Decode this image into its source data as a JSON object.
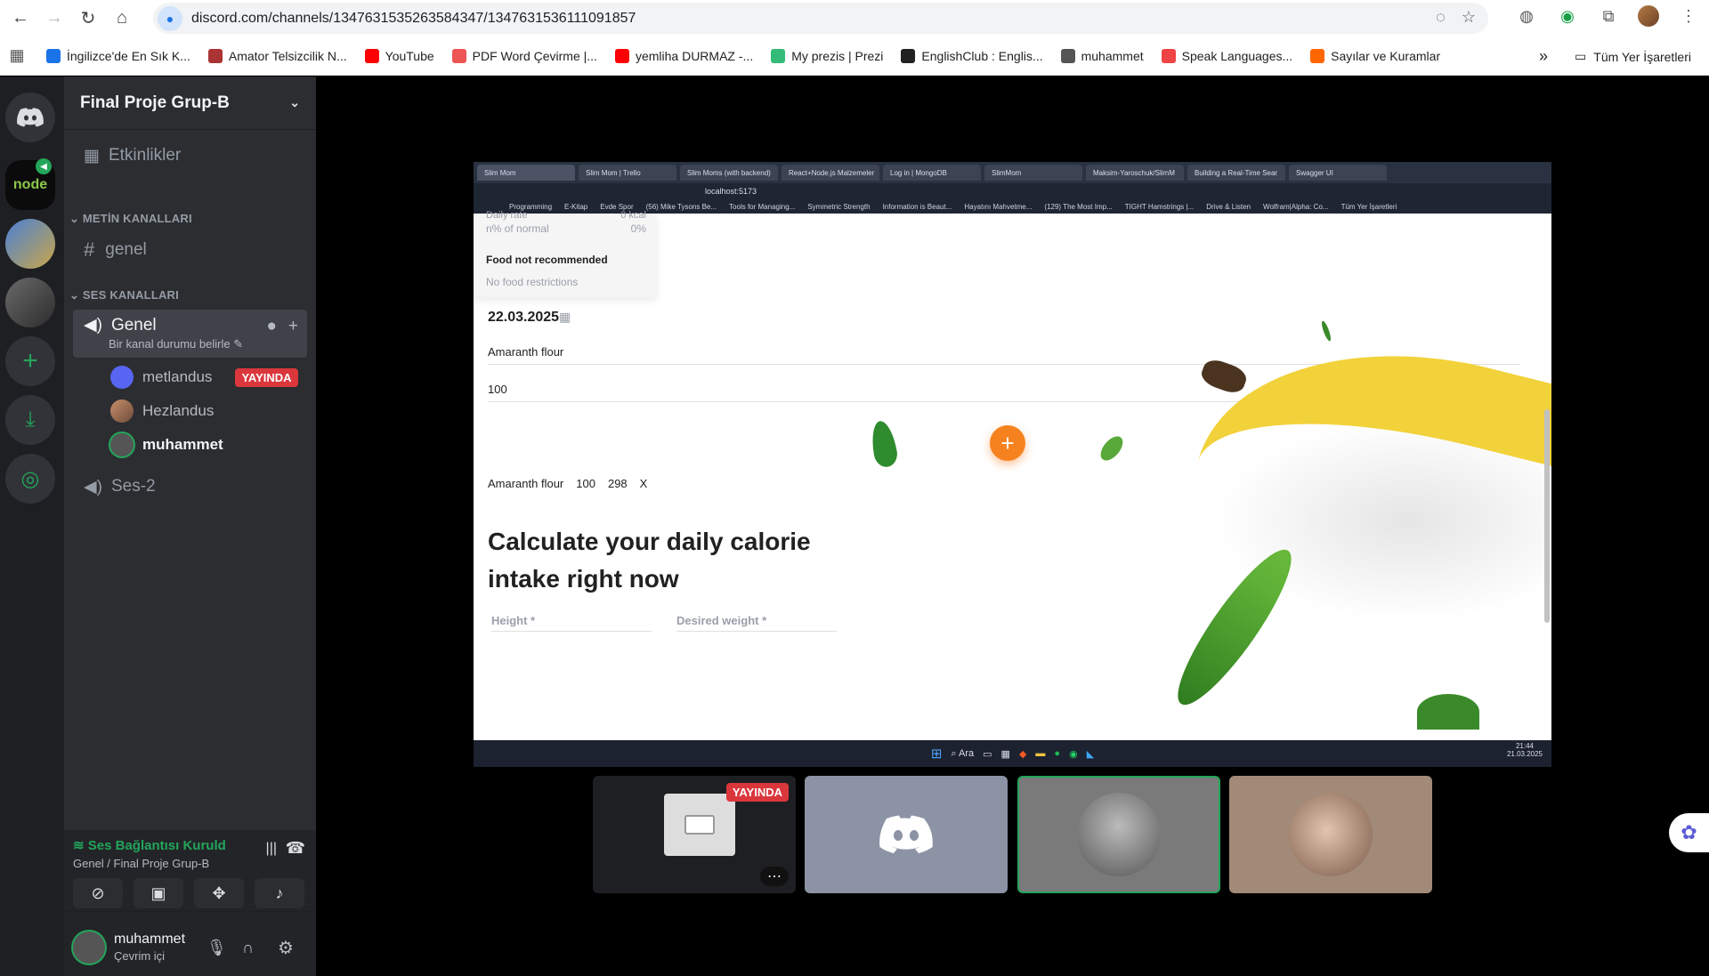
{
  "browser": {
    "url": "discord.com/channels/1347631535263584347/1347631536111091857",
    "bookmarks": [
      {
        "label": "İngilizce'de En Sık K...",
        "color": "#1a73e8"
      },
      {
        "label": "Amator Telsizcilik N...",
        "color": "#a33"
      },
      {
        "label": "YouTube",
        "color": "#f00"
      },
      {
        "label": "PDF Word Çevirme |...",
        "color": "#e55"
      },
      {
        "label": "yemliha DURMAZ -...",
        "color": "#f00"
      },
      {
        "label": "My prezis | Prezi",
        "color": "#3b7"
      },
      {
        "label": "EnglishClub : Englis...",
        "color": "#222"
      },
      {
        "label": "muhammet",
        "color": "#555"
      },
      {
        "label": "Speak Languages...",
        "color": "#e44"
      },
      {
        "label": "Sayılar ve Kuramlar",
        "color": "#f60"
      }
    ],
    "bookmarks_more": "»",
    "all_bookmarks": "Tüm Yer İşaretleri"
  },
  "discord": {
    "server_name": "Final Proje Grup-B",
    "events": "Etkinlikler",
    "text_category": "METİN KANALLARI",
    "text_channel": "genel",
    "voice_category": "SES KANALLARI",
    "voice_channel": "Genel",
    "voice_channel_status": "Bir kanal durumu belirle",
    "voice_users": [
      {
        "name": "metlandus",
        "live": "YAYINDA"
      },
      {
        "name": "Hezlandus"
      },
      {
        "name": "muhammet"
      }
    ],
    "voice_channel_2": "Ses-2",
    "connection_status": "Ses Bağlantısı Kuruld",
    "connection_sub": "Genel / Final Proje Grup-B",
    "user_name": "muhammet",
    "user_status": "Çevrim içi"
  },
  "shared_screen": {
    "tabs": [
      "Slim Mom",
      "Slim Mom | Trello",
      "Slim Moms (with backend)",
      "React+Node.js Malzemeler",
      "Log in | MongoDB",
      "SlimMom",
      "Maksim-Yaroschuk/SlimM",
      "Building a Real-Time Sear",
      "Swagger UI"
    ],
    "url": "localhost:5173",
    "bookmarks": [
      "Programming",
      "E-Kitap",
      "Evde Spor",
      "(56) Mike Tysons Be...",
      "Tools for Managing...",
      "Symmetric Strength",
      "Information is Beaut...",
      "Hayatını Mahvetme...",
      "(129) The Most Imp...",
      "TIGHT Hamstrings |...",
      "Drive & Listen",
      "Wolfram|Alpha: Co...",
      "Tüm Yer İşaretleri"
    ],
    "summary_rows": [
      {
        "label": "Daily rate",
        "value": "0 kcal"
      },
      {
        "label": "n% of normal",
        "value": "0%"
      }
    ],
    "food_title": "Food not recommended",
    "food_text": "No food restrictions",
    "date": "22.03.2025",
    "product_value": "Amaranth flour",
    "grams_value": "100",
    "entry": {
      "name": "Amaranth flour",
      "grams": "100",
      "kcal": "298",
      "remove": "X"
    },
    "headline": "Calculate your daily calorie intake right now",
    "height_label": "Height *",
    "desired_label": "Desired weight *",
    "taskbar_search": "Ara",
    "clock_time": "21:44",
    "clock_date": "21.03.2025"
  },
  "tiles": {
    "live_badge": "YAYINDA"
  },
  "colors": {
    "discord_green": "#23a55a",
    "live_red": "#da373c",
    "add_orange": "#f5821f"
  }
}
